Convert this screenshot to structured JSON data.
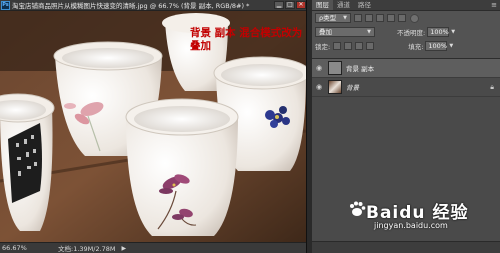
{
  "document": {
    "ps_badge": "Ps",
    "title": "淘宝店铺商品照片从模糊图片快速变的清晰.jpg @ 66.7% (背景 副本, RGB/8#) *",
    "minimize_label": "▁",
    "maximize_label": "□",
    "close_label": "✕",
    "overlay_caption": "背景 副本 混合模式改为叠加",
    "status": {
      "zoom": "66.67%",
      "doc_size": "文档:1.39M/2.78M",
      "arrow": "▶"
    }
  },
  "panels": {
    "tabs": [
      "图层",
      "通道",
      "路径"
    ],
    "menu_icon": "≡",
    "filter_kind": "ρ类型",
    "blend_mode": "叠加",
    "opacity_label": "不透明度:",
    "opacity_value": "100%",
    "lock_label": "锁定:",
    "fill_label": "填充:",
    "fill_value": "100%",
    "layers": [
      {
        "name": "背景 副本",
        "visible": true,
        "locked": false,
        "selected": true
      },
      {
        "name": "背景",
        "visible": true,
        "locked": true,
        "selected": false
      }
    ]
  },
  "watermark": {
    "brand": "Baidu 经验",
    "url": "jingyan.baidu.com"
  },
  "colors": {
    "caption_red": "#c20000",
    "panel_bg": "#535353",
    "titlebar_bg": "#3a3a3a"
  }
}
